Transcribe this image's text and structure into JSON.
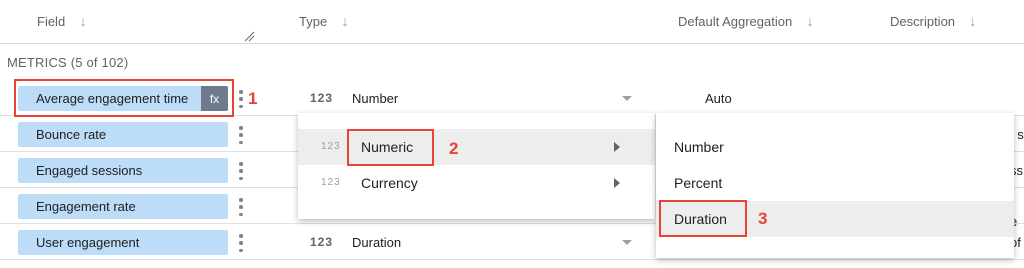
{
  "header": {
    "field": "Field",
    "type": "Type",
    "aggregation": "Default Aggregation",
    "description": "Description",
    "sort_icon": "arrow-down-icon"
  },
  "section_label": "METRICS (5 of 102)",
  "rows": [
    {
      "name": "Average engagement time",
      "fx": "fx",
      "type_icon": "123",
      "type": "Number",
      "aggregation": "Auto",
      "desc": ""
    },
    {
      "name": "Bounce rate",
      "desc": "f s"
    },
    {
      "name": "Engaged sessions",
      "desc": "ss"
    },
    {
      "name": "Engagement rate",
      "desc": "f e"
    },
    {
      "name": "User engagement",
      "type_icon": "123",
      "type": "Duration",
      "desc": "of"
    }
  ],
  "type_menu": {
    "items": [
      {
        "icon": "123",
        "label": "Numeric"
      },
      {
        "icon": "123",
        "label": "Currency"
      }
    ]
  },
  "numeric_submenu": {
    "items": [
      "Number",
      "Percent",
      "Duration"
    ]
  },
  "callouts": [
    "1",
    "2",
    "3"
  ],
  "colors": {
    "chip": "#bcdcf7",
    "highlight": "#ea4335",
    "fx_bg": "#6d7b8d"
  }
}
